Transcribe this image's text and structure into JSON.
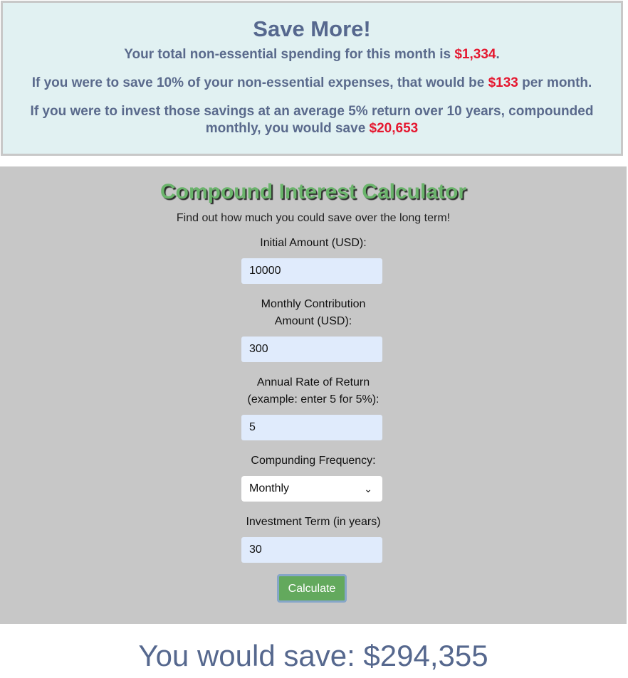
{
  "save_more": {
    "title": "Save More!",
    "line1_prefix": "Your total non-essential spending for this month is ",
    "line1_amount": "$1,334",
    "line1_suffix": ".",
    "line2_prefix": "If you were to save 10% of your non-essential expenses, that would be ",
    "line2_amount": "$133",
    "line2_suffix": " per month.",
    "line3_prefix": "If you were to invest those savings at an average 5% return over 10 years, compounded monthly, you would save ",
    "line3_amount": "$20,653"
  },
  "calculator": {
    "title": "Compound Interest Calculator",
    "subtitle": "Find out how much you could save over the long term!",
    "initial_label": "Initial Amount (USD):",
    "initial_value": "10000",
    "monthly_label": "Monthly Contribution Amount (USD):",
    "monthly_value": "300",
    "rate_label": "Annual Rate of Return (example: enter 5 for 5%):",
    "rate_value": "5",
    "frequency_label": "Compunding Frequency:",
    "frequency_selected": "Monthly",
    "term_label": "Investment Term (in years)",
    "term_value": "30",
    "button_label": "Calculate"
  },
  "result": {
    "text": "You would save: $294,355"
  }
}
